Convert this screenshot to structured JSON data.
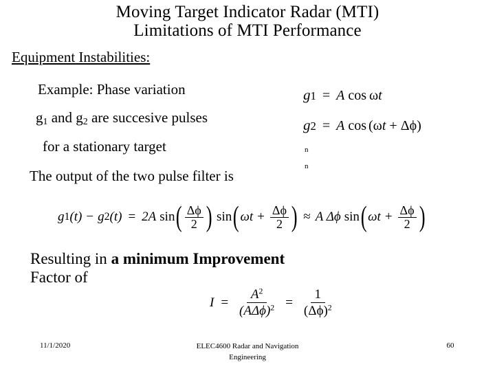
{
  "slide": {
    "title_line_1": "Moving Target Indicator Radar (MTI)",
    "title_line_2": "Limitations of MTI Performance",
    "section_heading": "Equipment Instabilities:",
    "body": {
      "line_example": "Example: Phase variation",
      "line_pulses_pre": "g",
      "line_pulses_sub1": "1",
      "line_pulses_mid": " and g",
      "line_pulses_sub2": "2",
      "line_pulses_post": " are succesive pulses",
      "line_target": "for a stationary target",
      "line_output": "The output of the two pulse filter is"
    },
    "stray_marks": {
      "mark_1": "n",
      "mark_2": "n"
    },
    "equations": {
      "g1": {
        "lhs_var": "g",
        "lhs_sub": "1",
        "eq": "=",
        "rhs_amp": "A",
        "rhs_fn": "cos",
        "rhs_omega": "ω",
        "rhs_t": "t"
      },
      "g2": {
        "lhs_var": "g",
        "lhs_sub": "2",
        "eq": "=",
        "rhs_amp": "A",
        "rhs_fn": "cos",
        "rhs_open": "(",
        "rhs_omega": "ω",
        "rhs_t": "t",
        "rhs_plus": "+",
        "rhs_delta": "Δ",
        "rhs_phi": "ϕ",
        "rhs_close": ")"
      },
      "two_pulse_filter": {
        "g1": "g",
        "g1_sub": "1",
        "arg1": "(t)",
        "minus": "−",
        "g2": "g",
        "g2_sub": "2",
        "arg2": "(t)",
        "equals": "=",
        "coeff": "2A",
        "sin1": "sin",
        "frac1_num": "Δϕ",
        "frac1_den": "2",
        "sin2": "sin",
        "omega_t": "ωt",
        "plus": "+",
        "frac2_num": "Δϕ",
        "frac2_den": "2",
        "approx": "≈",
        "amp_delta": "A Δϕ",
        "sin3": "sin",
        "omega_t2": "ωt",
        "plus2": "+",
        "frac3_num": "Δϕ",
        "frac3_den": "2"
      },
      "improvement_factor": {
        "lhs": "I",
        "equals_1": "=",
        "num_1_base": "A",
        "num_1_exp": "2",
        "den_1_base": "(AΔϕ)",
        "den_1_exp": "2",
        "equals_2": "=",
        "num_2": "1",
        "den_2_base": "(Δϕ)",
        "den_2_exp": "2"
      }
    },
    "result_text": {
      "regular_prefix": "Resulting in ",
      "bold_part": "a minimum Improvement",
      "second_line": "Factor of"
    },
    "footer": {
      "date": "11/1/2020",
      "center_line_1": "ELEC4600 Radar and Navigation",
      "center_line_2": "Engineering",
      "page_number": "60"
    }
  }
}
